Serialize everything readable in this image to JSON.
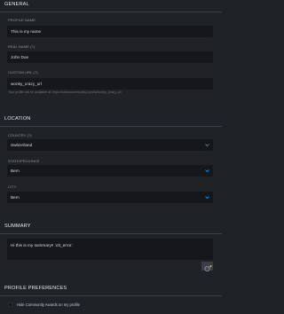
{
  "general": {
    "header": "GENERAL",
    "profile_name": {
      "label": "PROFILE NAME",
      "value": "This is my name"
    },
    "real_name": {
      "label": "REAL NAME (?)",
      "value": "John Doe"
    },
    "custom_url": {
      "label": "CUSTOM URL (?)",
      "value": "wonky_crazy_url",
      "hint": "Your profile will be available at: https://steamcommunity.com/id/wonky_crazy_url/"
    }
  },
  "location": {
    "header": "LOCATION",
    "country": {
      "label": "COUNTRY (?)",
      "value": "Switzerland"
    },
    "state": {
      "label": "STATE/PROVINCE",
      "value": "Bern"
    },
    "city": {
      "label": "CITY",
      "value": "Bern"
    }
  },
  "summary": {
    "header": "SUMMARY",
    "text": "Hi this is my summary!! :ctt_error:"
  },
  "profile_preferences": {
    "header": "PROFILE PREFERENCES",
    "hide_awards": {
      "label": "Hide Community Awards on my profile",
      "checked": false
    }
  },
  "icons": {
    "dropdown": "chevron-down-icon",
    "emoticon": "emoticon-icon"
  },
  "colors": {
    "background": "#1f2227",
    "field_background": "#15171b",
    "chevron": "#1a9fff",
    "emoticon_accent": "#e0b040"
  }
}
